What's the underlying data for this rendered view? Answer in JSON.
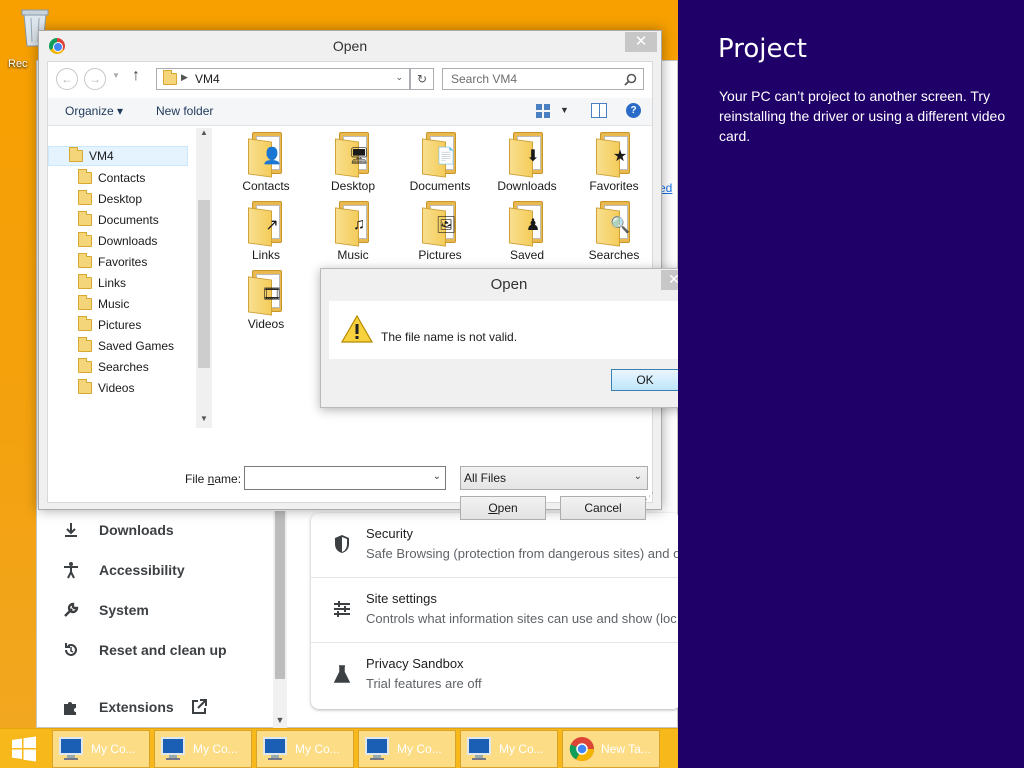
{
  "desktop": {
    "recycle_bin_label": "Rec"
  },
  "open_dialog": {
    "title": "Open",
    "close_glyph": "✕",
    "address_path": "VM4",
    "search_placeholder": "Search VM4",
    "toolbar": {
      "organize": "Organize ▾",
      "new_folder": "New folder"
    },
    "tree": {
      "root": "VM4",
      "items": [
        "Contacts",
        "Desktop",
        "Documents",
        "Downloads",
        "Favorites",
        "Links",
        "Music",
        "Pictures",
        "Saved Games",
        "Searches",
        "Videos"
      ]
    },
    "files": [
      {
        "name": "Contacts",
        "badge": "👤"
      },
      {
        "name": "Desktop",
        "badge": "🖥"
      },
      {
        "name": "Documents",
        "badge": "📄"
      },
      {
        "name": "Downloads",
        "badge": "⬇"
      },
      {
        "name": "Favorites",
        "badge": "★"
      },
      {
        "name": "Links",
        "badge": "↗"
      },
      {
        "name": "Music",
        "badge": "♫"
      },
      {
        "name": "Pictures",
        "badge": "🖼"
      },
      {
        "name": "Saved",
        "badge": "♟"
      },
      {
        "name": "Searches",
        "badge": "🔍"
      },
      {
        "name": "Videos",
        "badge": "🎞"
      }
    ],
    "file_name_label_prefix": "File ",
    "file_name_label_accel": "n",
    "file_name_label_suffix": "ame:",
    "file_name_value": "",
    "file_type_selected": "All Files",
    "open_button_accel": "O",
    "open_button_rest": "pen",
    "cancel_button": "Cancel"
  },
  "error_dialog": {
    "title": "Open",
    "message": "The file name is not valid.",
    "ok_button": "OK",
    "close_glyph": "✕"
  },
  "chrome_settings": {
    "nav": [
      {
        "label": "Downloads",
        "icon": "download-icon"
      },
      {
        "label": "Accessibility",
        "icon": "accessibility-icon"
      },
      {
        "label": "System",
        "icon": "wrench-icon"
      },
      {
        "label": "Reset and clean up",
        "icon": "reset-icon"
      },
      {
        "label": "Extensions",
        "icon": "puzzle-icon"
      }
    ],
    "rows": [
      {
        "title": "Security",
        "subtitle": "Safe Browsing (protection from dangerous sites) and o",
        "icon": "shield-icon"
      },
      {
        "title": "Site settings",
        "subtitle": "Controls what information sites can use and show (loc",
        "icon": "sliders-icon"
      },
      {
        "title": "Privacy Sandbox",
        "subtitle": "Trial features are off",
        "icon": "flask-icon"
      }
    ],
    "side_link": "ed"
  },
  "taskbar": {
    "buttons": [
      {
        "label": "My Co...",
        "icon": "computer-icon"
      },
      {
        "label": "My Co...",
        "icon": "computer-icon"
      },
      {
        "label": "My Co...",
        "icon": "computer-icon"
      },
      {
        "label": "My Co...",
        "icon": "computer-icon"
      },
      {
        "label": "My Co...",
        "icon": "computer-icon"
      },
      {
        "label": "New Ta...",
        "icon": "chrome-icon"
      }
    ]
  },
  "project_panel": {
    "title": "Project",
    "message": "Your PC can’t project to another screen. Try reinstalling the driver or using a different video card."
  },
  "colors": {
    "desktop_bg": "#f7a000",
    "project_bg": "#1f0068",
    "chrome_blue": "#1a73e8"
  }
}
